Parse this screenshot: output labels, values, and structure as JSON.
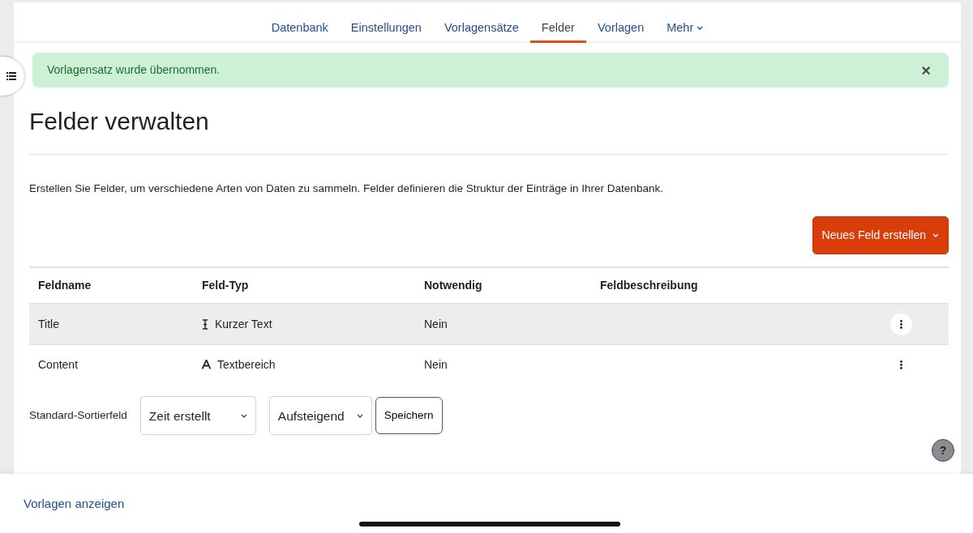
{
  "tabs": [
    {
      "label": "Datenbank",
      "selected": false
    },
    {
      "label": "Einstellungen",
      "selected": false
    },
    {
      "label": "Vorlagensätze",
      "selected": false
    },
    {
      "label": "Felder",
      "selected": true
    },
    {
      "label": "Vorlagen",
      "selected": false
    },
    {
      "label": "Mehr",
      "selected": false,
      "dropdown": true
    }
  ],
  "alert": {
    "message": "Vorlagensatz wurde übernommen.",
    "close": "×"
  },
  "heading": "Felder verwalten",
  "intro": "Erstellen Sie Felder, um verschiedene Arten von Daten zu sammeln. Felder definieren die Struktur der Einträge in Ihrer Datenbank.",
  "new_field_button": "Neues Feld erstellen",
  "table": {
    "columns": [
      "Feldname",
      "Feld-Typ",
      "Notwendig",
      "Feldbeschreibung"
    ],
    "rows": [
      {
        "name": "Title",
        "kind": "short_text",
        "type": "Kurzer Text",
        "required": "Nein",
        "selected": true
      },
      {
        "name": "Content",
        "kind": "textarea",
        "type": "Textbereich",
        "required": "Nein",
        "selected": false
      }
    ]
  },
  "sort": {
    "label": "Standard-Sortierfeld",
    "field": "Zeit erstellt",
    "order": "Aufsteigend",
    "save": "Speichern"
  },
  "help": "?",
  "footer_link": "Vorlagen anzeigen"
}
